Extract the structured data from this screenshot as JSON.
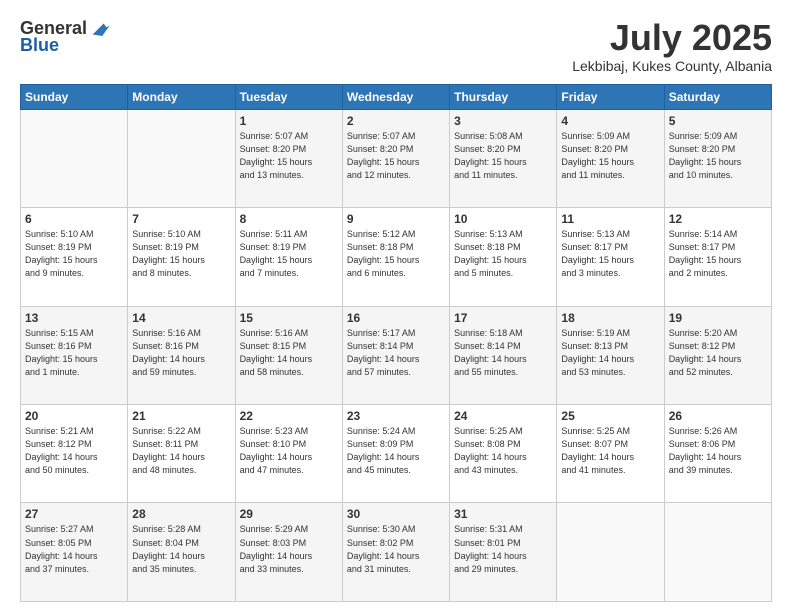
{
  "header": {
    "logo_general": "General",
    "logo_blue": "Blue",
    "month": "July 2025",
    "location": "Lekbibaj, Kukes County, Albania"
  },
  "weekdays": [
    "Sunday",
    "Monday",
    "Tuesday",
    "Wednesday",
    "Thursday",
    "Friday",
    "Saturday"
  ],
  "weeks": [
    [
      {
        "day": "",
        "info": ""
      },
      {
        "day": "",
        "info": ""
      },
      {
        "day": "1",
        "info": "Sunrise: 5:07 AM\nSunset: 8:20 PM\nDaylight: 15 hours\nand 13 minutes."
      },
      {
        "day": "2",
        "info": "Sunrise: 5:07 AM\nSunset: 8:20 PM\nDaylight: 15 hours\nand 12 minutes."
      },
      {
        "day": "3",
        "info": "Sunrise: 5:08 AM\nSunset: 8:20 PM\nDaylight: 15 hours\nand 11 minutes."
      },
      {
        "day": "4",
        "info": "Sunrise: 5:09 AM\nSunset: 8:20 PM\nDaylight: 15 hours\nand 11 minutes."
      },
      {
        "day": "5",
        "info": "Sunrise: 5:09 AM\nSunset: 8:20 PM\nDaylight: 15 hours\nand 10 minutes."
      }
    ],
    [
      {
        "day": "6",
        "info": "Sunrise: 5:10 AM\nSunset: 8:19 PM\nDaylight: 15 hours\nand 9 minutes."
      },
      {
        "day": "7",
        "info": "Sunrise: 5:10 AM\nSunset: 8:19 PM\nDaylight: 15 hours\nand 8 minutes."
      },
      {
        "day": "8",
        "info": "Sunrise: 5:11 AM\nSunset: 8:19 PM\nDaylight: 15 hours\nand 7 minutes."
      },
      {
        "day": "9",
        "info": "Sunrise: 5:12 AM\nSunset: 8:18 PM\nDaylight: 15 hours\nand 6 minutes."
      },
      {
        "day": "10",
        "info": "Sunrise: 5:13 AM\nSunset: 8:18 PM\nDaylight: 15 hours\nand 5 minutes."
      },
      {
        "day": "11",
        "info": "Sunrise: 5:13 AM\nSunset: 8:17 PM\nDaylight: 15 hours\nand 3 minutes."
      },
      {
        "day": "12",
        "info": "Sunrise: 5:14 AM\nSunset: 8:17 PM\nDaylight: 15 hours\nand 2 minutes."
      }
    ],
    [
      {
        "day": "13",
        "info": "Sunrise: 5:15 AM\nSunset: 8:16 PM\nDaylight: 15 hours\nand 1 minute."
      },
      {
        "day": "14",
        "info": "Sunrise: 5:16 AM\nSunset: 8:16 PM\nDaylight: 14 hours\nand 59 minutes."
      },
      {
        "day": "15",
        "info": "Sunrise: 5:16 AM\nSunset: 8:15 PM\nDaylight: 14 hours\nand 58 minutes."
      },
      {
        "day": "16",
        "info": "Sunrise: 5:17 AM\nSunset: 8:14 PM\nDaylight: 14 hours\nand 57 minutes."
      },
      {
        "day": "17",
        "info": "Sunrise: 5:18 AM\nSunset: 8:14 PM\nDaylight: 14 hours\nand 55 minutes."
      },
      {
        "day": "18",
        "info": "Sunrise: 5:19 AM\nSunset: 8:13 PM\nDaylight: 14 hours\nand 53 minutes."
      },
      {
        "day": "19",
        "info": "Sunrise: 5:20 AM\nSunset: 8:12 PM\nDaylight: 14 hours\nand 52 minutes."
      }
    ],
    [
      {
        "day": "20",
        "info": "Sunrise: 5:21 AM\nSunset: 8:12 PM\nDaylight: 14 hours\nand 50 minutes."
      },
      {
        "day": "21",
        "info": "Sunrise: 5:22 AM\nSunset: 8:11 PM\nDaylight: 14 hours\nand 48 minutes."
      },
      {
        "day": "22",
        "info": "Sunrise: 5:23 AM\nSunset: 8:10 PM\nDaylight: 14 hours\nand 47 minutes."
      },
      {
        "day": "23",
        "info": "Sunrise: 5:24 AM\nSunset: 8:09 PM\nDaylight: 14 hours\nand 45 minutes."
      },
      {
        "day": "24",
        "info": "Sunrise: 5:25 AM\nSunset: 8:08 PM\nDaylight: 14 hours\nand 43 minutes."
      },
      {
        "day": "25",
        "info": "Sunrise: 5:25 AM\nSunset: 8:07 PM\nDaylight: 14 hours\nand 41 minutes."
      },
      {
        "day": "26",
        "info": "Sunrise: 5:26 AM\nSunset: 8:06 PM\nDaylight: 14 hours\nand 39 minutes."
      }
    ],
    [
      {
        "day": "27",
        "info": "Sunrise: 5:27 AM\nSunset: 8:05 PM\nDaylight: 14 hours\nand 37 minutes."
      },
      {
        "day": "28",
        "info": "Sunrise: 5:28 AM\nSunset: 8:04 PM\nDaylight: 14 hours\nand 35 minutes."
      },
      {
        "day": "29",
        "info": "Sunrise: 5:29 AM\nSunset: 8:03 PM\nDaylight: 14 hours\nand 33 minutes."
      },
      {
        "day": "30",
        "info": "Sunrise: 5:30 AM\nSunset: 8:02 PM\nDaylight: 14 hours\nand 31 minutes."
      },
      {
        "day": "31",
        "info": "Sunrise: 5:31 AM\nSunset: 8:01 PM\nDaylight: 14 hours\nand 29 minutes."
      },
      {
        "day": "",
        "info": ""
      },
      {
        "day": "",
        "info": ""
      }
    ]
  ]
}
